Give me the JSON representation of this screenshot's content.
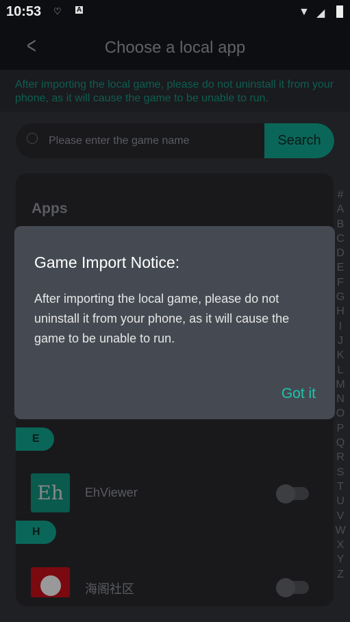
{
  "status_bar": {
    "time": "10:53",
    "icons": [
      "notification-icon",
      "a-icon",
      "wifi-icon",
      "signal-icon",
      "battery-charging-icon"
    ]
  },
  "header": {
    "title": "Choose a local app",
    "back_icon": "chevron-left-icon"
  },
  "notice": "After importing the local game, please do not uninstall it from your phone, as it will cause the game to be unable to run.",
  "search": {
    "placeholder": "Please enter the game name",
    "button": "Search"
  },
  "list": {
    "section_title": "Apps",
    "groups": [
      {
        "letter": "E",
        "apps": [
          {
            "name": "EhViewer",
            "icon_text": "Eh",
            "enabled": false
          }
        ]
      },
      {
        "letter": "H",
        "apps": [
          {
            "name": "海阁社区",
            "enabled": false
          }
        ]
      }
    ]
  },
  "index": [
    "#",
    "A",
    "B",
    "C",
    "D",
    "E",
    "F",
    "G",
    "H",
    "I",
    "J",
    "K",
    "L",
    "M",
    "N",
    "O",
    "P",
    "Q",
    "R",
    "S",
    "T",
    "U",
    "V",
    "W",
    "X",
    "Y",
    "Z"
  ],
  "dialog": {
    "title": "Game Import Notice:",
    "body": "After importing the local game, please do not uninstall it from your phone, as it will cause the game to be unable to run.",
    "button": "Got it"
  },
  "colors": {
    "accent": "#1fc6ae",
    "teal_dim": "#0a6658"
  }
}
